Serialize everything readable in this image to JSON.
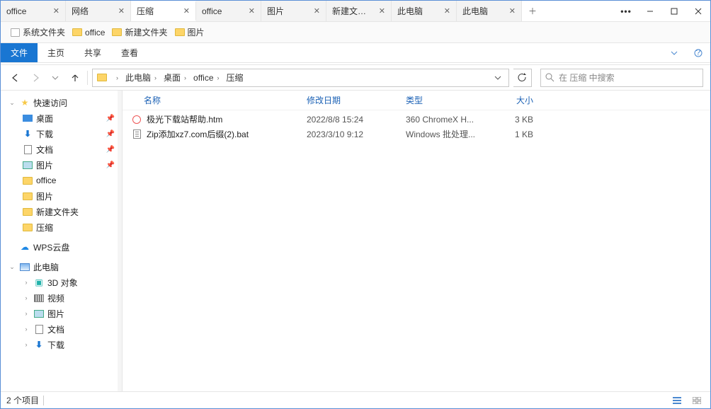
{
  "tabs": [
    {
      "label": "office"
    },
    {
      "label": "网络"
    },
    {
      "label": "压缩",
      "active": true
    },
    {
      "label": "office"
    },
    {
      "label": "图片"
    },
    {
      "label": "新建文件夹"
    },
    {
      "label": "此电脑"
    },
    {
      "label": "此电脑"
    }
  ],
  "bookmarks": [
    {
      "label": "系统文件夹",
      "sys": true
    },
    {
      "label": "office"
    },
    {
      "label": "新建文件夹"
    },
    {
      "label": "图片"
    }
  ],
  "ribbon": {
    "file": "文件",
    "home": "主页",
    "share": "共享",
    "view": "查看"
  },
  "path": {
    "crumbs": [
      "此电脑",
      "桌面",
      "office",
      "压缩"
    ]
  },
  "search": {
    "placeholder": "在 压缩 中搜索"
  },
  "sidebar": {
    "quick": "快速访问",
    "items_quick": [
      {
        "label": "桌面",
        "icon": "blue",
        "pinned": true
      },
      {
        "label": "下载",
        "icon": "arrow",
        "pinned": true
      },
      {
        "label": "文档",
        "icon": "doc",
        "pinned": true
      },
      {
        "label": "图片",
        "icon": "img",
        "pinned": true
      },
      {
        "label": "office",
        "icon": "folder"
      },
      {
        "label": "图片",
        "icon": "folder"
      },
      {
        "label": "新建文件夹",
        "icon": "folder"
      },
      {
        "label": "压缩",
        "icon": "folder"
      }
    ],
    "wps": "WPS云盘",
    "thispc": "此电脑",
    "items_pc": [
      {
        "label": "3D 对象",
        "icon": "3d"
      },
      {
        "label": "视频",
        "icon": "vid"
      },
      {
        "label": "图片",
        "icon": "img"
      },
      {
        "label": "文档",
        "icon": "doc"
      },
      {
        "label": "下载",
        "icon": "arrow"
      }
    ]
  },
  "columns": {
    "name": "名称",
    "date": "修改日期",
    "type": "类型",
    "size": "大小"
  },
  "files": [
    {
      "name": "极光下载站帮助.htm",
      "date": "2022/8/8 15:24",
      "type": "360 ChromeX H...",
      "size": "3 KB",
      "icon": "htm"
    },
    {
      "name": "Zip添加xz7.com后缀(2).bat",
      "date": "2023/3/10 9:12",
      "type": "Windows 批处理...",
      "size": "1 KB",
      "icon": "bat"
    }
  ],
  "status": {
    "count": "2 个项目"
  }
}
